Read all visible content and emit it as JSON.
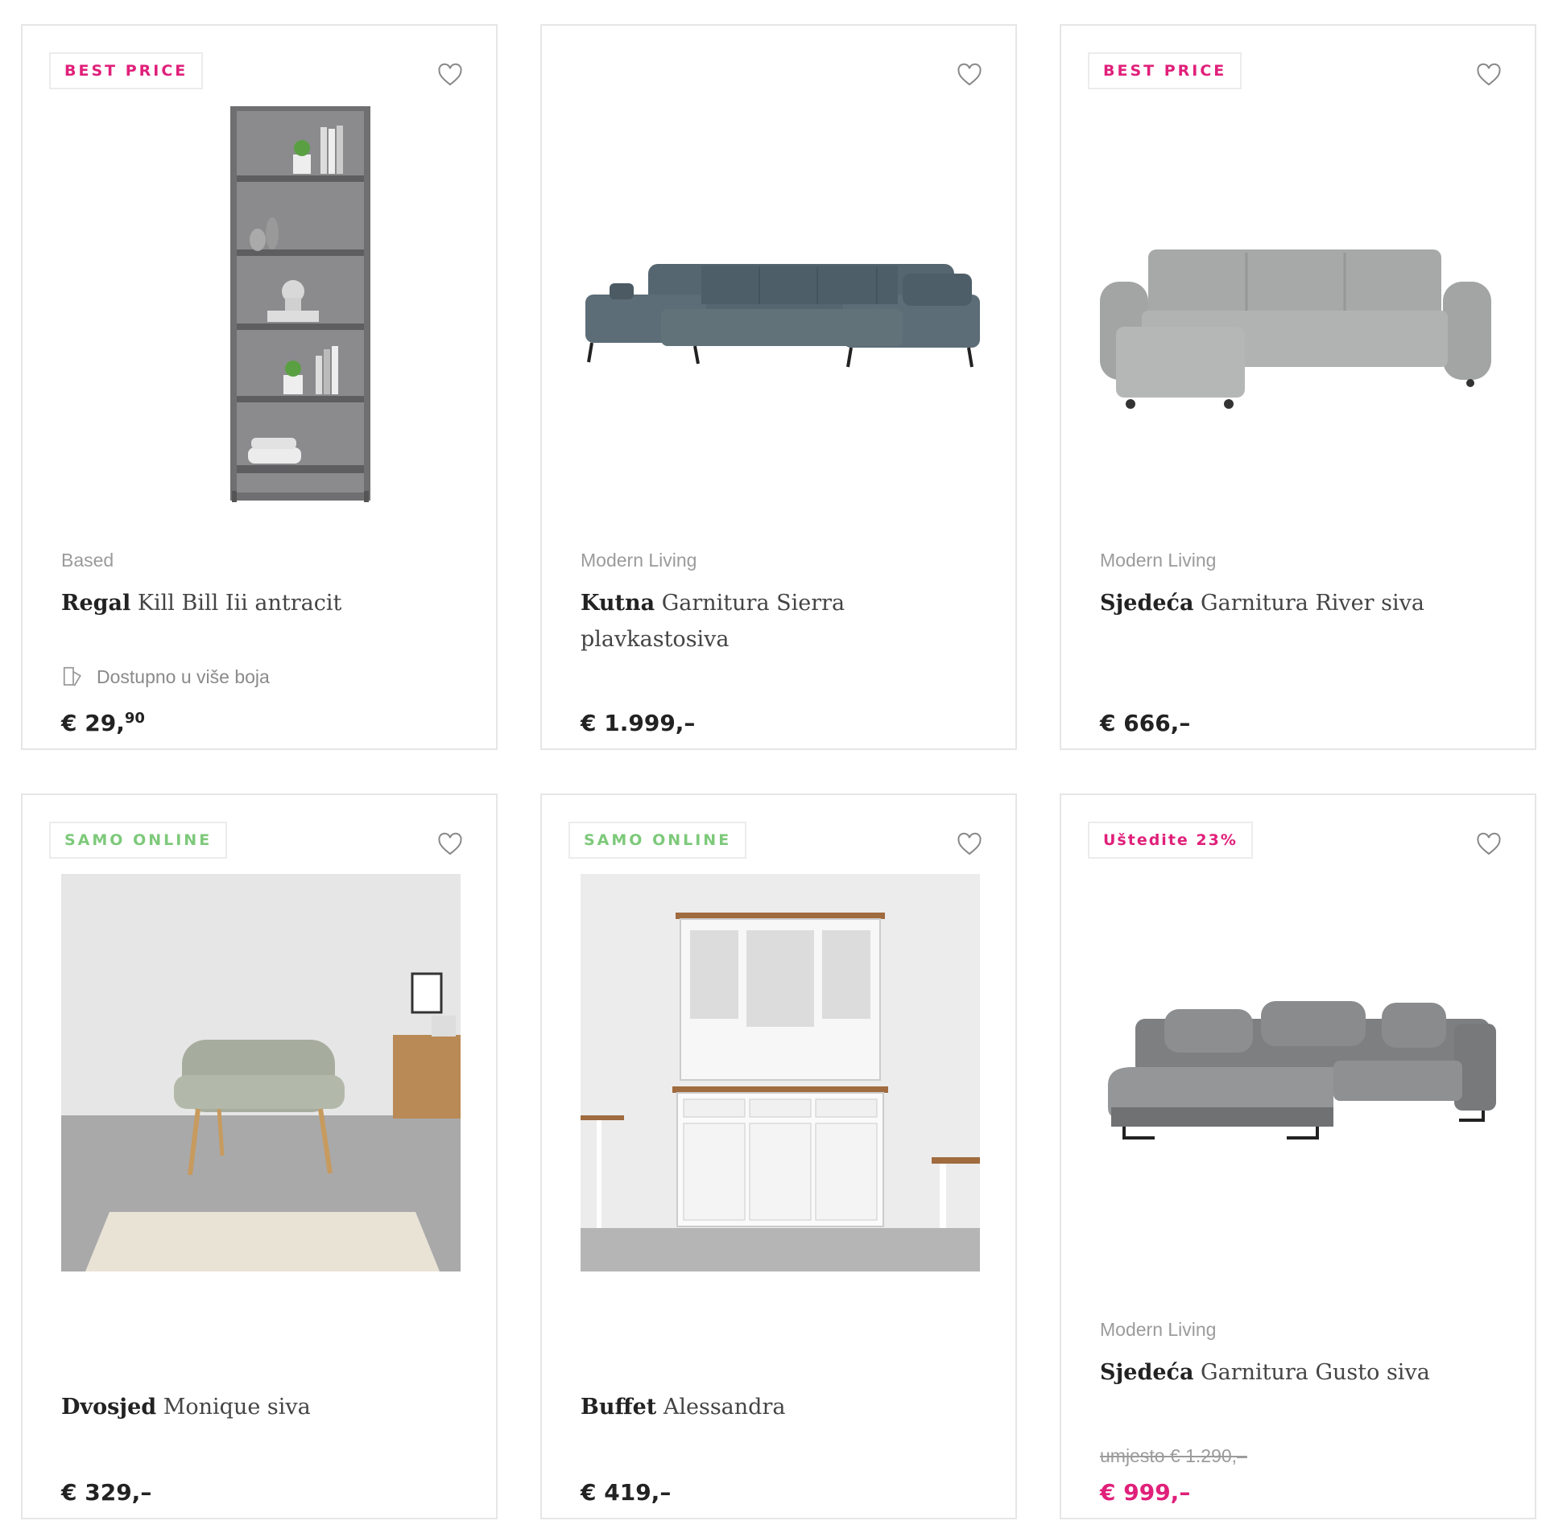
{
  "products": [
    {
      "badge": "BEST PRICE",
      "brand": "Based",
      "title_bold": "Regal",
      "title_rest": "Kill Bill Iii antracit",
      "colors_text": "Dostupno u više boja",
      "price_main": "€ 29,",
      "price_cents": "90"
    },
    {
      "brand": "Modern Living",
      "title_bold": "Kutna",
      "title_rest": "Garnitura Sierra plavkastosiva",
      "price": "€ 1.999,–"
    },
    {
      "badge": "BEST PRICE",
      "brand": "Modern Living",
      "title_bold": "Sjedeća",
      "title_rest": "Garnitura River siva",
      "price": "€ 666,–"
    },
    {
      "badge": "SAMO ONLINE",
      "title_bold": "Dvosjed",
      "title_rest": "Monique siva",
      "price": "€ 329,–"
    },
    {
      "badge": "SAMO ONLINE",
      "title_bold": "Buffet",
      "title_rest": "Alessandra",
      "price": "€ 419,–"
    },
    {
      "badge": "Uštedite 23%",
      "brand": "Modern Living",
      "title_bold": "Sjedeća",
      "title_rest": "Garnitura Gusto siva",
      "old_price": "umjesto € 1.290,–",
      "price": "€ 999,–"
    }
  ],
  "icons": {
    "wishlist": "heart-outline-icon",
    "colors": "color-swatch-icon"
  },
  "colors": {
    "badge_pink": "#e0207a",
    "badge_green": "#7dc97a",
    "sale_price": "#e0207a"
  }
}
